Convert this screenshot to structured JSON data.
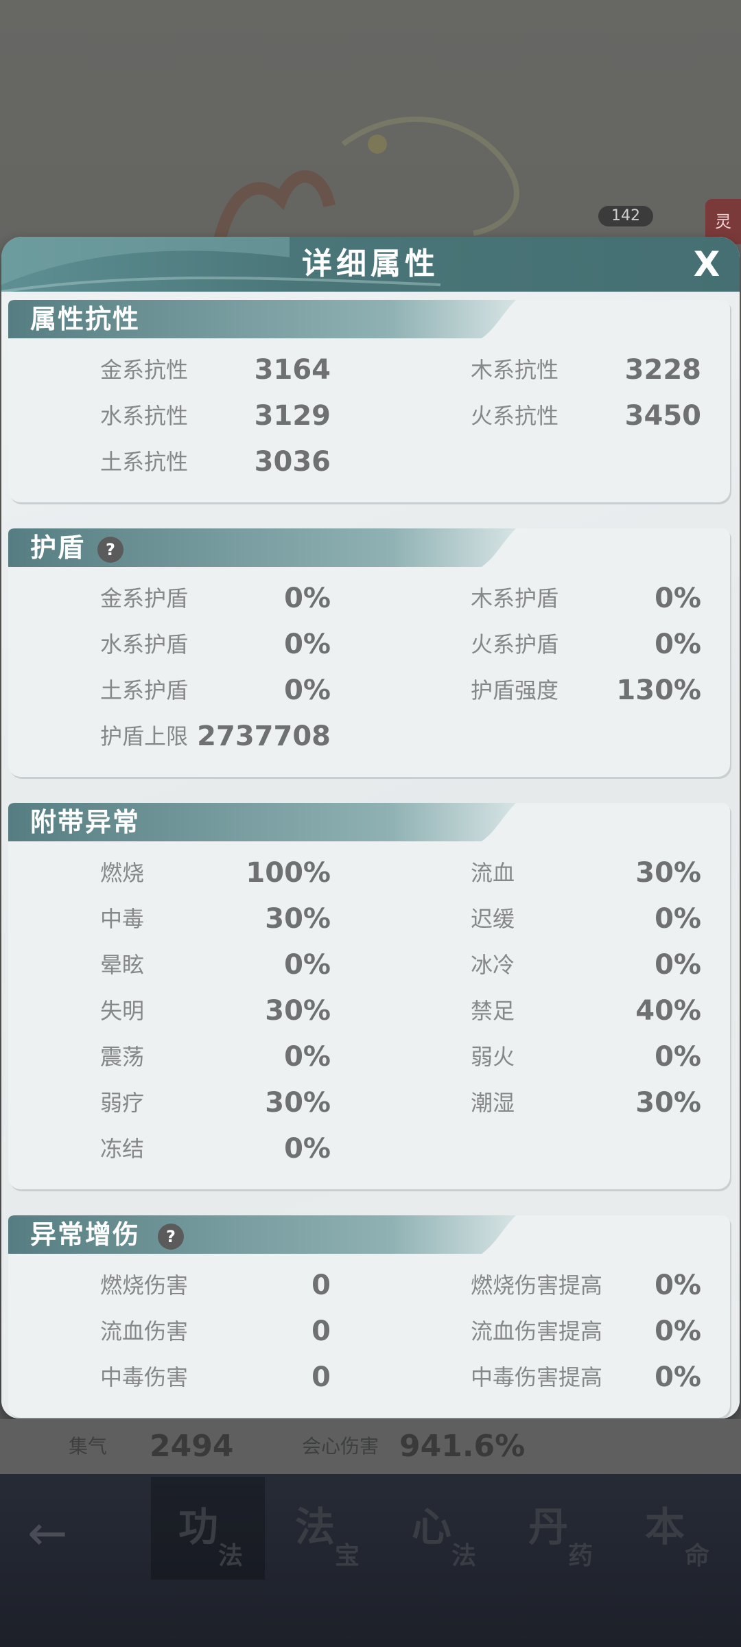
{
  "background": {
    "level_badge": "142",
    "side_tab": "灵"
  },
  "modal": {
    "title": "详细属性",
    "close_label": "X",
    "sections": [
      {
        "title": "属性抗性",
        "help": false,
        "rows": [
          [
            {
              "label": "金系抗性",
              "value": "3164"
            },
            {
              "label": "木系抗性",
              "value": "3228"
            }
          ],
          [
            {
              "label": "水系抗性",
              "value": "3129"
            },
            {
              "label": "火系抗性",
              "value": "3450"
            }
          ],
          [
            {
              "label": "土系抗性",
              "value": "3036"
            }
          ]
        ]
      },
      {
        "title": "护盾",
        "help": true,
        "rows": [
          [
            {
              "label": "金系护盾",
              "value": "0%"
            },
            {
              "label": "木系护盾",
              "value": "0%"
            }
          ],
          [
            {
              "label": "水系护盾",
              "value": "0%"
            },
            {
              "label": "火系护盾",
              "value": "0%"
            }
          ],
          [
            {
              "label": "土系护盾",
              "value": "0%"
            },
            {
              "label": "护盾强度",
              "value": "130%"
            }
          ],
          [
            {
              "label": "护盾上限",
              "value": "2737708"
            }
          ]
        ]
      },
      {
        "title": "附带异常",
        "help": false,
        "rows": [
          [
            {
              "label": "燃烧",
              "value": "100%"
            },
            {
              "label": "流血",
              "value": "30%"
            }
          ],
          [
            {
              "label": "中毒",
              "value": "30%"
            },
            {
              "label": "迟缓",
              "value": "0%"
            }
          ],
          [
            {
              "label": "晕眩",
              "value": "0%"
            },
            {
              "label": "冰冷",
              "value": "0%"
            }
          ],
          [
            {
              "label": "失明",
              "value": "30%"
            },
            {
              "label": "禁足",
              "value": "40%"
            }
          ],
          [
            {
              "label": "震荡",
              "value": "0%"
            },
            {
              "label": "弱火",
              "value": "0%"
            }
          ],
          [
            {
              "label": "弱疗",
              "value": "30%"
            },
            {
              "label": "潮湿",
              "value": "30%"
            }
          ],
          [
            {
              "label": "冻结",
              "value": "0%"
            }
          ]
        ]
      },
      {
        "title": "异常增伤",
        "help": true,
        "rows": [
          [
            {
              "label": "燃烧伤害",
              "value": "0"
            },
            {
              "label": "燃烧伤害提高",
              "value": "0%"
            }
          ],
          [
            {
              "label": "流血伤害",
              "value": "0"
            },
            {
              "label": "流血伤害提高",
              "value": "0%"
            }
          ],
          [
            {
              "label": "中毒伤害",
              "value": "0"
            },
            {
              "label": "中毒伤害提高",
              "value": "0%"
            }
          ]
        ]
      }
    ]
  },
  "status": {
    "qi_label": "集气",
    "qi_value": "2494",
    "crit_label": "会心伤害",
    "crit_value": "941.6%"
  },
  "tabs": [
    {
      "main": "功",
      "sub": "法",
      "active": true
    },
    {
      "main": "法",
      "sub": "宝",
      "active": false
    },
    {
      "main": "心",
      "sub": "法",
      "active": false
    },
    {
      "main": "丹",
      "sub": "药",
      "active": false
    },
    {
      "main": "本",
      "sub": "命",
      "active": false
    }
  ],
  "back_icon": "arrow-left-icon"
}
